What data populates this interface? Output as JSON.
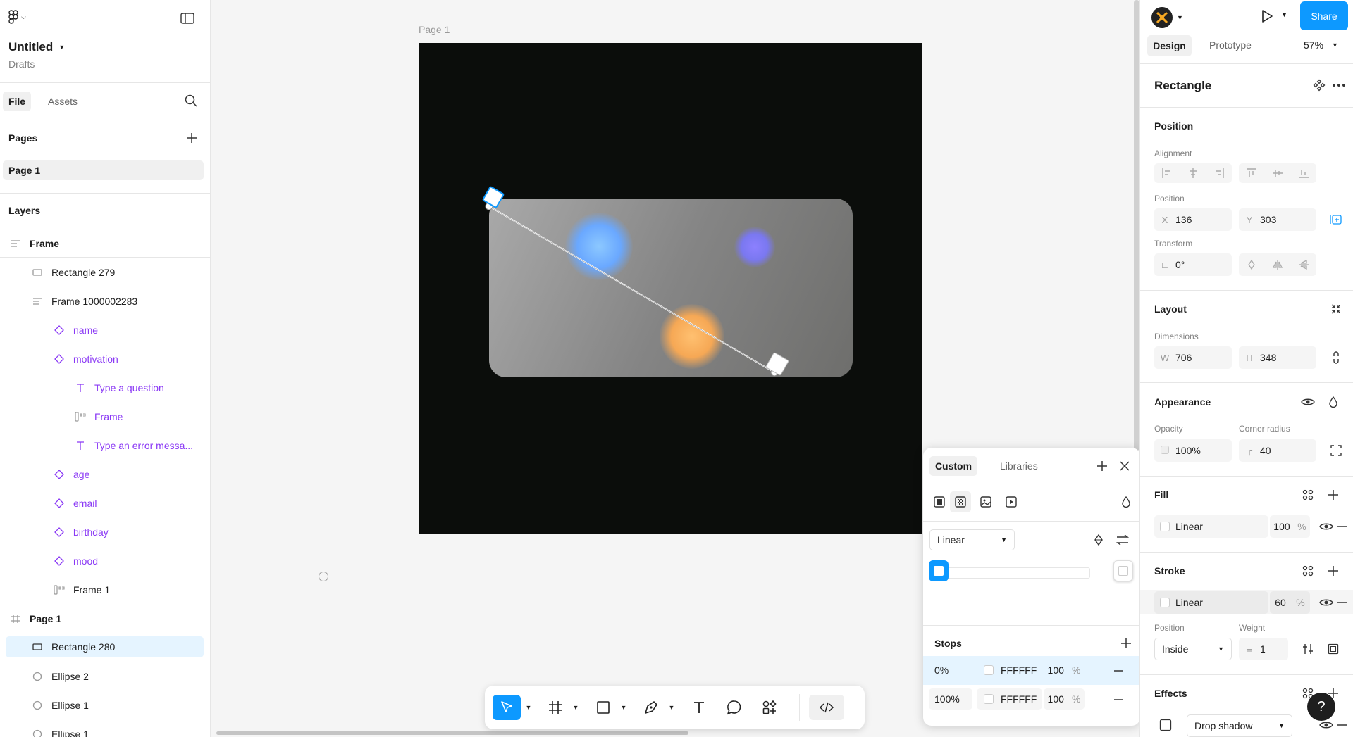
{
  "app": {
    "file_name": "Untitled",
    "location": "Drafts",
    "share_label": "Share",
    "zoom": "57%"
  },
  "left_panel": {
    "tabs": [
      "File",
      "Assets"
    ],
    "pages_label": "Pages",
    "pages": [
      "Page 1"
    ],
    "layers_label": "Layers",
    "layers": [
      {
        "name": "Frame",
        "icon": "frame-group-icon",
        "indent": 0,
        "bold": true
      },
      {
        "name": "Rectangle 279",
        "icon": "rectangle-icon",
        "indent": 1
      },
      {
        "name": "Frame 1000002283",
        "icon": "frame-group-icon",
        "indent": 1
      },
      {
        "name": "name",
        "icon": "component-instance-icon",
        "indent": 2,
        "purple": true
      },
      {
        "name": "motivation",
        "icon": "component-instance-icon",
        "indent": 2,
        "purple": true
      },
      {
        "name": "Type a question",
        "icon": "text-icon",
        "indent": 3,
        "purple": true
      },
      {
        "name": "Frame",
        "icon": "auto-layout-icon",
        "indent": 3,
        "purple": true
      },
      {
        "name": "Type an error messa...",
        "icon": "text-icon",
        "indent": 3,
        "purple": true
      },
      {
        "name": "age",
        "icon": "component-instance-icon",
        "indent": 2,
        "purple": true
      },
      {
        "name": "email",
        "icon": "component-instance-icon",
        "indent": 2,
        "purple": true
      },
      {
        "name": "birthday",
        "icon": "component-instance-icon",
        "indent": 2,
        "purple": true
      },
      {
        "name": "mood",
        "icon": "component-instance-icon",
        "indent": 2,
        "purple": true
      },
      {
        "name": "Frame 1",
        "icon": "auto-layout-icon",
        "indent": 2
      },
      {
        "name": "Page 1",
        "icon": "frame-hash-icon",
        "indent": 0,
        "bold": true
      },
      {
        "name": "Rectangle 280",
        "icon": "rectangle-icon",
        "indent": 1,
        "selected": true
      },
      {
        "name": "Ellipse 2",
        "icon": "ellipse-icon",
        "indent": 1
      },
      {
        "name": "Ellipse 1",
        "icon": "ellipse-icon",
        "indent": 1
      },
      {
        "name": "Ellipse 1",
        "icon": "ellipse-icon",
        "indent": 1
      }
    ]
  },
  "canvas": {
    "frame_label": "Page 1"
  },
  "right_panel": {
    "tabs": [
      "Design",
      "Prototype"
    ],
    "selection_title": "Rectangle",
    "position_title": "Position",
    "alignment_label": "Alignment",
    "position_label": "Position",
    "x_label": "X",
    "x_value": "136",
    "y_label": "Y",
    "y_value": "303",
    "transform_label": "Transform",
    "rotation_value": "0°",
    "layout_title": "Layout",
    "dimensions_label": "Dimensions",
    "w_label": "W",
    "w_value": "706",
    "h_label": "H",
    "h_value": "348",
    "appearance_title": "Appearance",
    "opacity_label": "Opacity",
    "opacity_value": "100%",
    "radius_label": "Corner radius",
    "radius_value": "40",
    "fill_title": "Fill",
    "fill_type": "Linear",
    "fill_opacity": "100",
    "percent": "%",
    "stroke_title": "Stroke",
    "stroke_type": "Linear",
    "stroke_opacity": "60",
    "stroke_position_label": "Position",
    "stroke_position": "Inside",
    "weight_label": "Weight",
    "weight_value": "1",
    "effects_title": "Effects",
    "effect_type": "Drop shadow"
  },
  "picker": {
    "tabs": [
      "Custom",
      "Libraries"
    ],
    "gradient_type": "Linear",
    "stops_title": "Stops",
    "stops": [
      {
        "position": "0%",
        "hex": "FFFFFF",
        "opacity": "100",
        "unit": "%"
      },
      {
        "position": "100%",
        "hex": "FFFFFF",
        "opacity": "100",
        "unit": "%"
      }
    ]
  },
  "help_label": "?",
  "colors": {
    "accent": "#0d99ff",
    "selection": "#e5f4ff",
    "purple": "#8a38f5",
    "frame_bg": "#0b0d0b"
  }
}
